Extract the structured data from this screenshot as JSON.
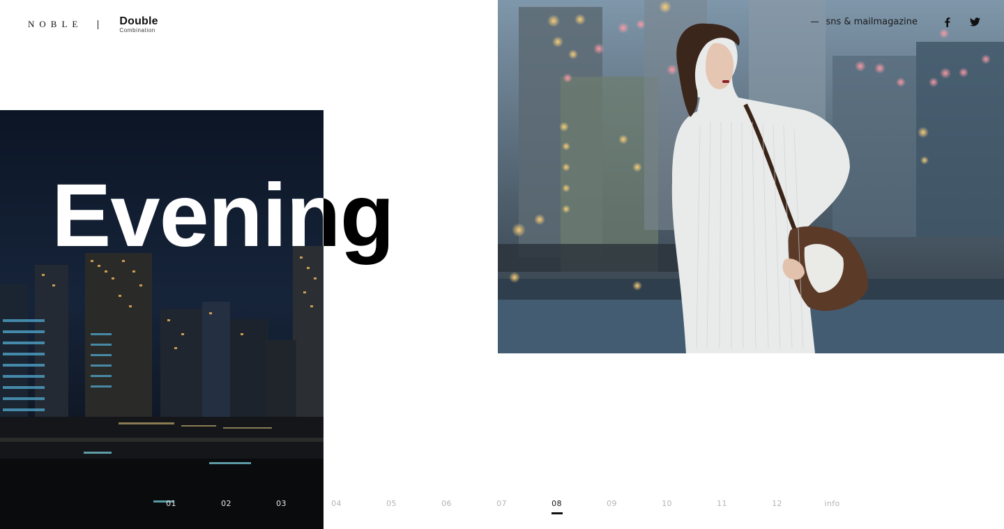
{
  "brand": {
    "noble": "NOBLE",
    "double": "Double",
    "combination": "Combination"
  },
  "nav": {
    "sns_link": "sns & mailmagazine",
    "facebook_icon": "facebook-icon",
    "twitter_icon": "twitter-icon"
  },
  "hero": {
    "title": "Evening"
  },
  "pager": {
    "items": [
      "01",
      "02",
      "03",
      "04",
      "05",
      "06",
      "07",
      "08",
      "09",
      "10",
      "11",
      "12",
      "info"
    ],
    "active": "08"
  },
  "colors": {
    "text": "#111111",
    "background": "#ffffff",
    "inactive_page": "#b3b3b3"
  }
}
